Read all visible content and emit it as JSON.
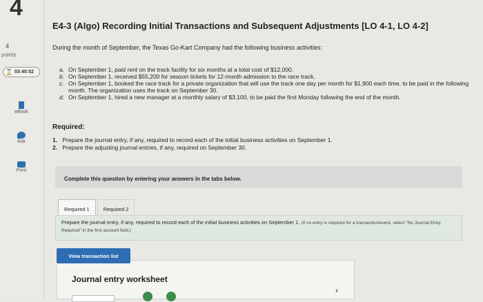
{
  "sidebar": {
    "question_number": "4",
    "points_value": "4",
    "points_label": "points",
    "timer": "03:40:52",
    "tools": [
      {
        "label": "eBook",
        "icon": "ebook-icon"
      },
      {
        "label": "Ask",
        "icon": "ask-icon"
      },
      {
        "label": "Print",
        "icon": "print-icon"
      }
    ]
  },
  "question": {
    "title": "E4-3 (Algo) Recording Initial Transactions and Subsequent Adjustments [LO 4-1, LO 4-2]",
    "intro": "During the month of September, the Texas Go-Kart Company had the following business activities:",
    "activities": [
      {
        "letter": "a.",
        "text": "On September 1, paid rent on the track facility for six months at a total cost of $12,000."
      },
      {
        "letter": "b.",
        "text": "On September 1, received $55,200 for season tickets for 12-month admission to the race track."
      },
      {
        "letter": "c.",
        "text": "On September 1, booked the race track for a private organization that will use the track one day per month for $1,900 each time, to be paid in the following month. The organization uses the track on September 30."
      },
      {
        "letter": "d.",
        "text": "On September 1, hired a new manager at a monthly salary of $3,100, to be paid the first Monday following the end of the month."
      }
    ],
    "required_heading": "Required:",
    "requirements": [
      {
        "num": "1.",
        "text": "Prepare the journal entry, if any, required to record each of the initial business activities on September 1."
      },
      {
        "num": "2.",
        "text": "Prepare the adjusting journal entries, if any, required on September 30."
      }
    ]
  },
  "instructions": "Complete this question by entering your answers in the tabs below.",
  "tabs": [
    {
      "label": "Required 1",
      "active": true
    },
    {
      "label": "Required 2",
      "active": false
    }
  ],
  "prompt": {
    "text": "Prepare the journal entry, if any, required to record each of the initial business activities on September 1.",
    "note": "(If no entry is required for a transaction/event, select \"No Journal Entry Required\" in the first account field.)"
  },
  "view_button": "View transaction list",
  "worksheet_title": "Journal entry worksheet",
  "next_icon": "chevron-right-icon",
  "colors": {
    "accent": "#2e6db4",
    "green": "#3b8d4a",
    "prompt_bg": "#dfe8e1"
  }
}
